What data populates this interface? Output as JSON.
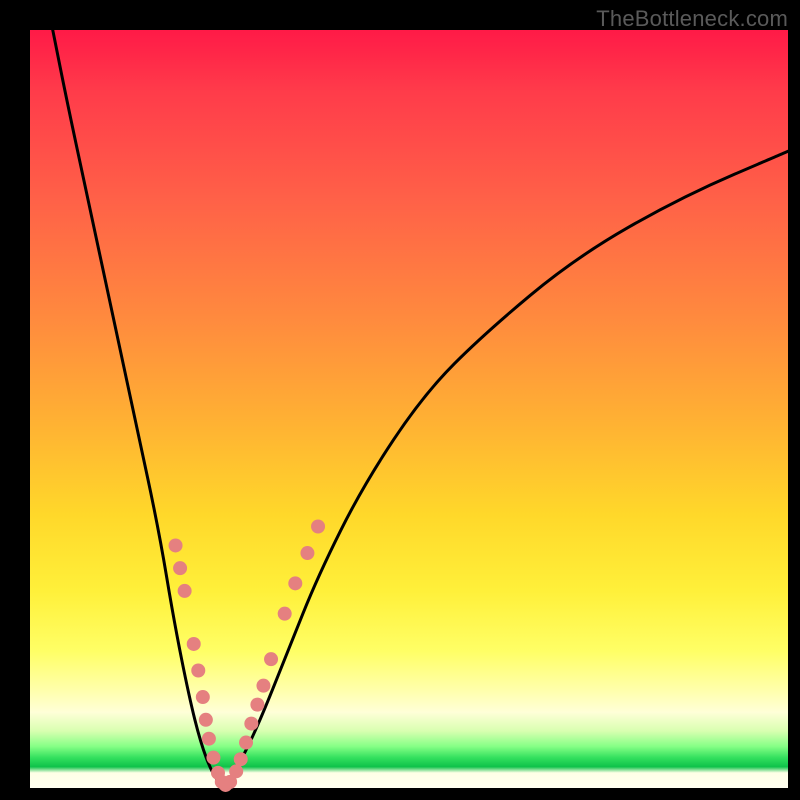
{
  "watermark": "TheBottleneck.com",
  "chart_data": {
    "type": "line",
    "title": "",
    "xlabel": "",
    "ylabel": "",
    "xlim": [
      0,
      100
    ],
    "ylim": [
      0,
      100
    ],
    "grid": false,
    "legend": false,
    "series": [
      {
        "name": "bottleneck-curve",
        "color": "#000000",
        "x": [
          3,
          5,
          8,
          11,
          14,
          17,
          19,
          21,
          22.5,
          24,
          25.5,
          27,
          30,
          34,
          38,
          44,
          52,
          60,
          72,
          86,
          100
        ],
        "y": [
          100,
          90,
          76,
          62,
          48,
          34,
          22,
          12,
          6,
          2,
          0,
          2,
          8,
          18,
          28,
          40,
          52,
          60,
          70,
          78,
          84
        ]
      }
    ],
    "markers": [
      {
        "name": "curve-dots",
        "color": "#e58080",
        "radius_px": 7,
        "points": [
          {
            "x": 19.2,
            "y": 32
          },
          {
            "x": 19.8,
            "y": 29
          },
          {
            "x": 20.4,
            "y": 26
          },
          {
            "x": 21.6,
            "y": 19
          },
          {
            "x": 22.2,
            "y": 15.5
          },
          {
            "x": 22.8,
            "y": 12
          },
          {
            "x": 23.2,
            "y": 9
          },
          {
            "x": 23.6,
            "y": 6.5
          },
          {
            "x": 24.2,
            "y": 4
          },
          {
            "x": 24.8,
            "y": 2
          },
          {
            "x": 25.3,
            "y": 0.8
          },
          {
            "x": 25.8,
            "y": 0.4
          },
          {
            "x": 26.4,
            "y": 0.8
          },
          {
            "x": 27.2,
            "y": 2.2
          },
          {
            "x": 27.8,
            "y": 3.8
          },
          {
            "x": 28.5,
            "y": 6
          },
          {
            "x": 29.2,
            "y": 8.5
          },
          {
            "x": 30.0,
            "y": 11
          },
          {
            "x": 30.8,
            "y": 13.5
          },
          {
            "x": 31.8,
            "y": 17
          },
          {
            "x": 33.6,
            "y": 23
          },
          {
            "x": 35.0,
            "y": 27
          },
          {
            "x": 36.6,
            "y": 31
          },
          {
            "x": 38.0,
            "y": 34.5
          }
        ]
      }
    ],
    "background_gradient": {
      "stops": [
        {
          "pos": 0,
          "color": "#ff1a47"
        },
        {
          "pos": 38,
          "color": "#ff8a3e"
        },
        {
          "pos": 74,
          "color": "#fff03a"
        },
        {
          "pos": 90,
          "color": "#ffffd8"
        },
        {
          "pos": 96,
          "color": "#0fc24a"
        },
        {
          "pos": 100,
          "color": "#fffff0"
        }
      ]
    }
  }
}
